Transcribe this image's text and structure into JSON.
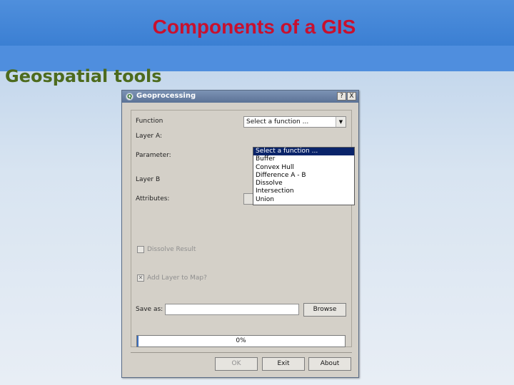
{
  "slide": {
    "title": "Components of a GIS",
    "subtitle": "Geospatial tools"
  },
  "dialog": {
    "title": "Geoprocessing",
    "icon": "qgis-icon",
    "icon_glyph": "Q",
    "help_button": "?",
    "close_button": "X",
    "form": {
      "function_label": "Function",
      "function_value": "Select a function ...",
      "function_options": [
        "Select a function ...",
        "Buffer",
        "Convex Hull",
        "Difference A - B",
        "Dissolve",
        "Intersection",
        "Union"
      ],
      "layer_a_label": "Layer A:",
      "parameter_label": "Parameter:",
      "layer_b_label": "Layer B",
      "attributes_label": "Attributes:",
      "attributes_value": "",
      "dissolve_label": "Dissolve Result",
      "dissolve_checked": false,
      "add_layer_label": "Add Layer to Map?",
      "add_layer_checked": true,
      "save_as_label": "Save as:",
      "save_as_value": "",
      "browse_label": "Browse",
      "progress_text": "0%",
      "progress_value": 0
    },
    "buttons": {
      "ok": "OK",
      "exit": "Exit",
      "about": "About"
    }
  },
  "colors": {
    "title": "#c8102e",
    "subtitle": "#4d6b1e",
    "selection": "#0a246a"
  }
}
